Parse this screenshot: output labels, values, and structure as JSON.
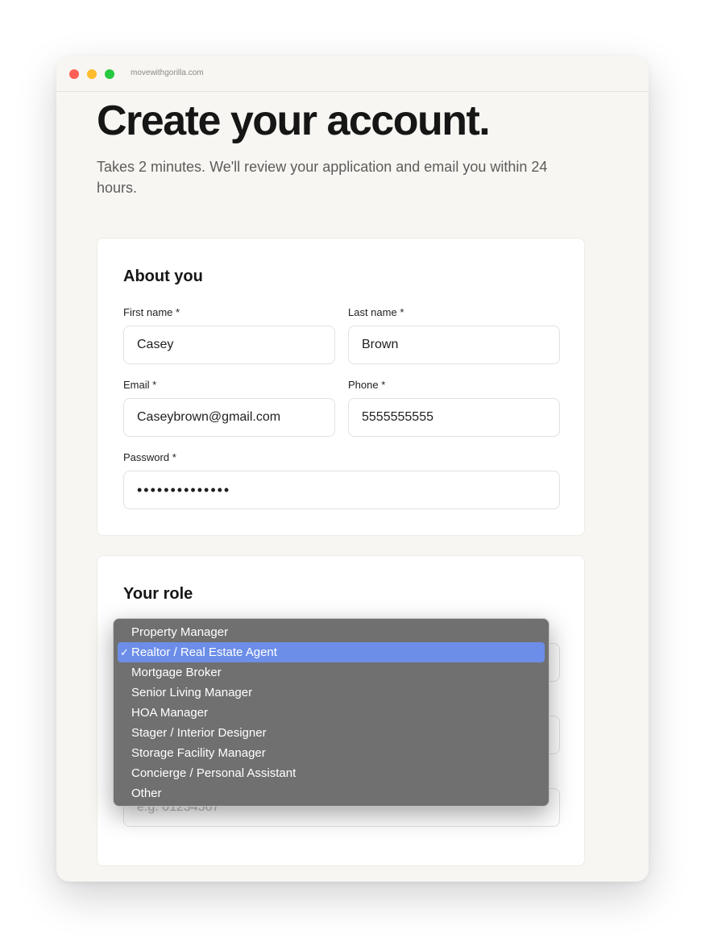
{
  "browser": {
    "url": "movewithgorilla.com",
    "traffic_lights": {
      "close": "#ff5f57",
      "minimize": "#febc2e",
      "maximize": "#28c840"
    }
  },
  "page": {
    "title": "Create your account.",
    "subtitle": "Takes 2 minutes. We'll review your application and email you within 24 hours."
  },
  "about": {
    "section_title": "About you",
    "first_name": {
      "label": "First name *",
      "value": "Casey"
    },
    "last_name": {
      "label": "Last name *",
      "value": "Brown"
    },
    "email": {
      "label": "Email *",
      "value": "Caseybrown@gmail.com"
    },
    "phone": {
      "label": "Phone *",
      "value": "5555555555"
    },
    "password": {
      "label": "Password *",
      "value": "••••••••••••••"
    }
  },
  "role": {
    "section_title": "Your role",
    "partial_placeholder": "e.g. 01234567",
    "dropdown": {
      "selected_index": 1,
      "check_mark": "✓",
      "selected_color": "#6c8ee8",
      "options": [
        "Property Manager",
        "Realtor / Real Estate Agent",
        "Mortgage Broker",
        "Senior Living Manager",
        "HOA Manager",
        "Stager / Interior Designer",
        "Storage Facility Manager",
        "Concierge / Personal Assistant",
        "Other"
      ]
    }
  }
}
